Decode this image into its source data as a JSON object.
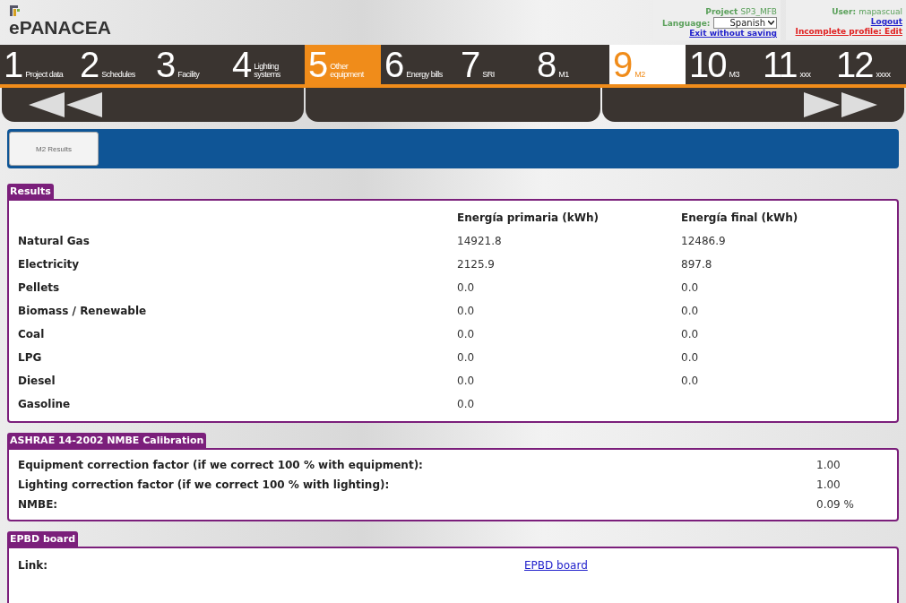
{
  "logo": "ePANACEA",
  "project": {
    "label": "Project",
    "value": "SP3_MFB"
  },
  "language": {
    "label": "Language:",
    "value": "Spanish"
  },
  "exit_link": "Exit without saving",
  "user": {
    "label": "User:",
    "value": "mapascual"
  },
  "logout_link": "Logout",
  "profile_link": "Incomplete profile: Edit",
  "steps": [
    {
      "number": "1",
      "label": "Project data",
      "selected": false,
      "highlighted": false
    },
    {
      "number": "2",
      "label": "Schedules",
      "selected": false,
      "highlighted": false
    },
    {
      "number": "3",
      "label": "Facility",
      "selected": false,
      "highlighted": false
    },
    {
      "number": "4",
      "label": "Lighting systems",
      "selected": false,
      "highlighted": false
    },
    {
      "number": "5",
      "label": "Other equipment",
      "selected": false,
      "highlighted": true
    },
    {
      "number": "6",
      "label": "Energy bills",
      "selected": false,
      "highlighted": false
    },
    {
      "number": "7",
      "label": "SRI",
      "selected": false,
      "highlighted": false
    },
    {
      "number": "8",
      "label": "M1",
      "selected": false,
      "highlighted": false
    },
    {
      "number": "9",
      "label": "M2",
      "selected": true,
      "highlighted": false
    },
    {
      "number": "10",
      "label": "M3",
      "selected": false,
      "highlighted": false
    },
    {
      "number": "11",
      "label": "xxx",
      "selected": false,
      "highlighted": false
    },
    {
      "number": "12",
      "label": "xxxx",
      "selected": false,
      "highlighted": false
    }
  ],
  "tabs": [
    {
      "label": "M2 Results",
      "selected": true
    }
  ],
  "results": {
    "title": "Results",
    "columns": [
      "Energía primaria (kWh)",
      "Energía final (kWh)"
    ],
    "rows": [
      {
        "name": "Natural Gas",
        "primary": "14921.8",
        "final": "12486.9"
      },
      {
        "name": "Electricity",
        "primary": "2125.9",
        "final": "897.8"
      },
      {
        "name": "Pellets",
        "primary": "0.0",
        "final": "0.0"
      },
      {
        "name": "Biomass / Renewable",
        "primary": "0.0",
        "final": "0.0"
      },
      {
        "name": "Coal",
        "primary": "0.0",
        "final": "0.0"
      },
      {
        "name": "LPG",
        "primary": "0.0",
        "final": "0.0"
      },
      {
        "name": "Diesel",
        "primary": "0.0",
        "final": "0.0"
      },
      {
        "name": "Gasoline",
        "primary": "0.0"
      }
    ]
  },
  "calibration": {
    "title": "ASHRAE 14-2002 NMBE Calibration",
    "rows": [
      {
        "name": "Equipment correction factor (if we correct 100 % with equipment):",
        "value": "1.00"
      },
      {
        "name": "Lighting correction factor (if we correct 100 % with lighting):",
        "value": "1.00"
      },
      {
        "name": "NMBE:",
        "value": "0.09 %"
      }
    ]
  },
  "epbd": {
    "title": "EPBD board",
    "label": "Link:",
    "link": "EPBD board"
  }
}
